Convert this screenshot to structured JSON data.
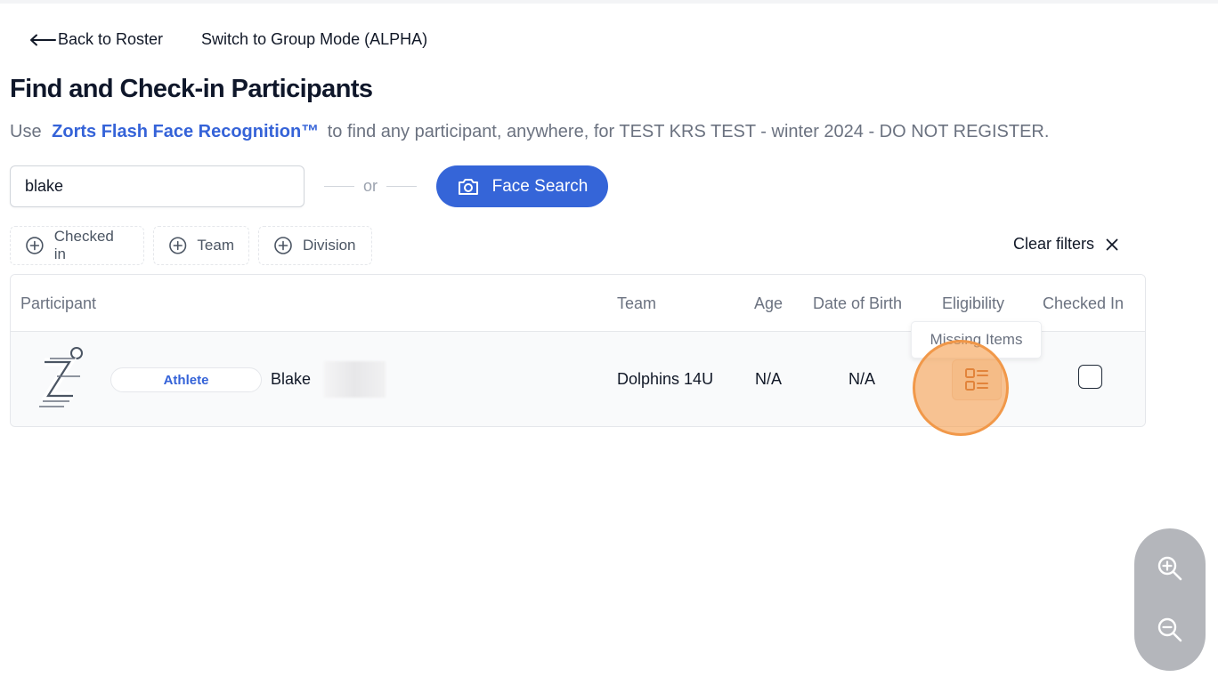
{
  "nav": {
    "back_label": "Back to Roster",
    "switch_label": "Switch to Group Mode (ALPHA)"
  },
  "page": {
    "title": "Find and Check-in Participants",
    "subtitle_pre": "Use",
    "subtitle_brand": "Zorts Flash Face Recognition™",
    "subtitle_post": "to find any participant, anywhere, for TEST KRS TEST - winter 2024 - DO NOT REGISTER."
  },
  "search": {
    "value": "blake",
    "or_label": "or",
    "face_button_label": "Face Search"
  },
  "filters": {
    "items": [
      {
        "label": "Checked in"
      },
      {
        "label": "Team"
      },
      {
        "label": "Division"
      }
    ],
    "clear_label": "Clear filters"
  },
  "table": {
    "columns": [
      "Participant",
      "Team",
      "Age",
      "Date of Birth",
      "Eligibility",
      "Checked In"
    ],
    "rows": [
      {
        "role": "Athlete",
        "first_name": "Blake",
        "team": "Dolphins 14U",
        "age": "N/A",
        "dob": "N/A",
        "eligibility_tooltip": "Missing Items",
        "checked_in": false
      }
    ]
  },
  "icons": {
    "back": "arrow-left-icon",
    "camera": "camera-icon",
    "plus_circle": "plus-circle-icon",
    "close": "close-icon",
    "eligibility": "list-details-icon",
    "zoom_in": "zoom-in-icon",
    "zoom_out": "zoom-out-icon"
  },
  "colors": {
    "accent": "#3565d8",
    "eligibility_icon": "#c2571a",
    "cursor_highlight": "#f5a050"
  }
}
